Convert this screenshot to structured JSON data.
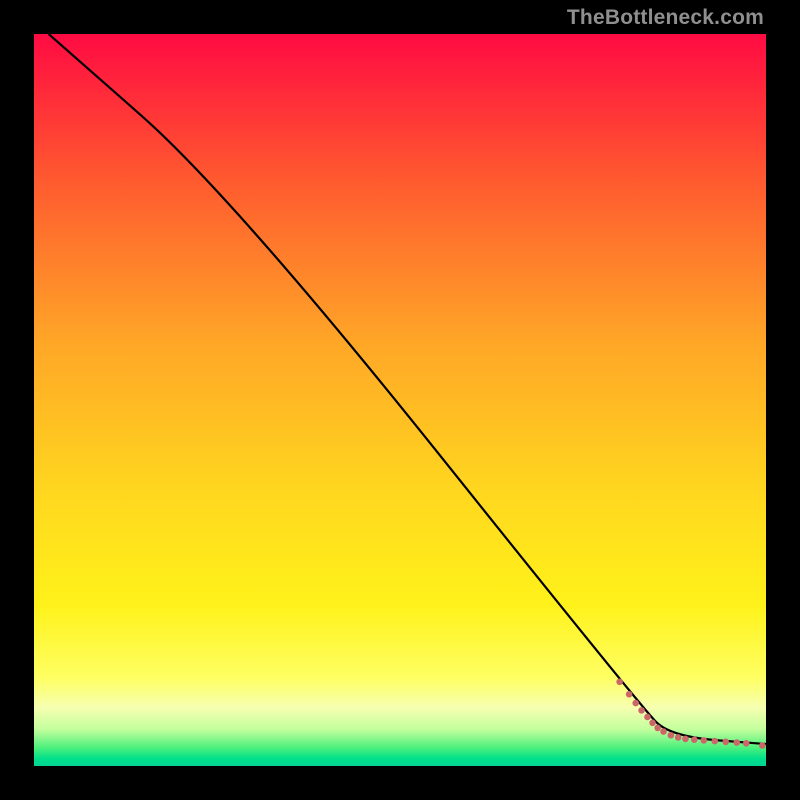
{
  "watermark": "TheBottleneck.com",
  "chart_data": {
    "type": "line",
    "title": "",
    "xlabel": "",
    "ylabel": "",
    "xlim": [
      0,
      100
    ],
    "ylim": [
      0,
      100
    ],
    "grid": false,
    "series": [
      {
        "name": "curve",
        "points": [
          {
            "x": 2,
            "y": 100
          },
          {
            "x": 27,
            "y": 78
          },
          {
            "x": 83,
            "y": 8
          },
          {
            "x": 87,
            "y": 4
          },
          {
            "x": 100,
            "y": 3
          }
        ],
        "color": "#000000"
      }
    ],
    "dots": {
      "color": "#cb6768",
      "radius_pct": 0.45,
      "points": [
        {
          "x": 80.0,
          "y": 11.5
        },
        {
          "x": 81.3,
          "y": 9.8
        },
        {
          "x": 82.2,
          "y": 8.6
        },
        {
          "x": 83.0,
          "y": 7.6
        },
        {
          "x": 83.8,
          "y": 6.7
        },
        {
          "x": 84.5,
          "y": 5.9
        },
        {
          "x": 85.2,
          "y": 5.2
        },
        {
          "x": 86.0,
          "y": 4.7
        },
        {
          "x": 87.0,
          "y": 4.2
        },
        {
          "x": 88.0,
          "y": 3.9
        },
        {
          "x": 89.0,
          "y": 3.7
        },
        {
          "x": 90.2,
          "y": 3.6
        },
        {
          "x": 91.5,
          "y": 3.5
        },
        {
          "x": 93.0,
          "y": 3.4
        },
        {
          "x": 94.5,
          "y": 3.3
        },
        {
          "x": 96.0,
          "y": 3.2
        },
        {
          "x": 97.3,
          "y": 3.1
        },
        {
          "x": 99.5,
          "y": 2.8
        }
      ]
    }
  }
}
